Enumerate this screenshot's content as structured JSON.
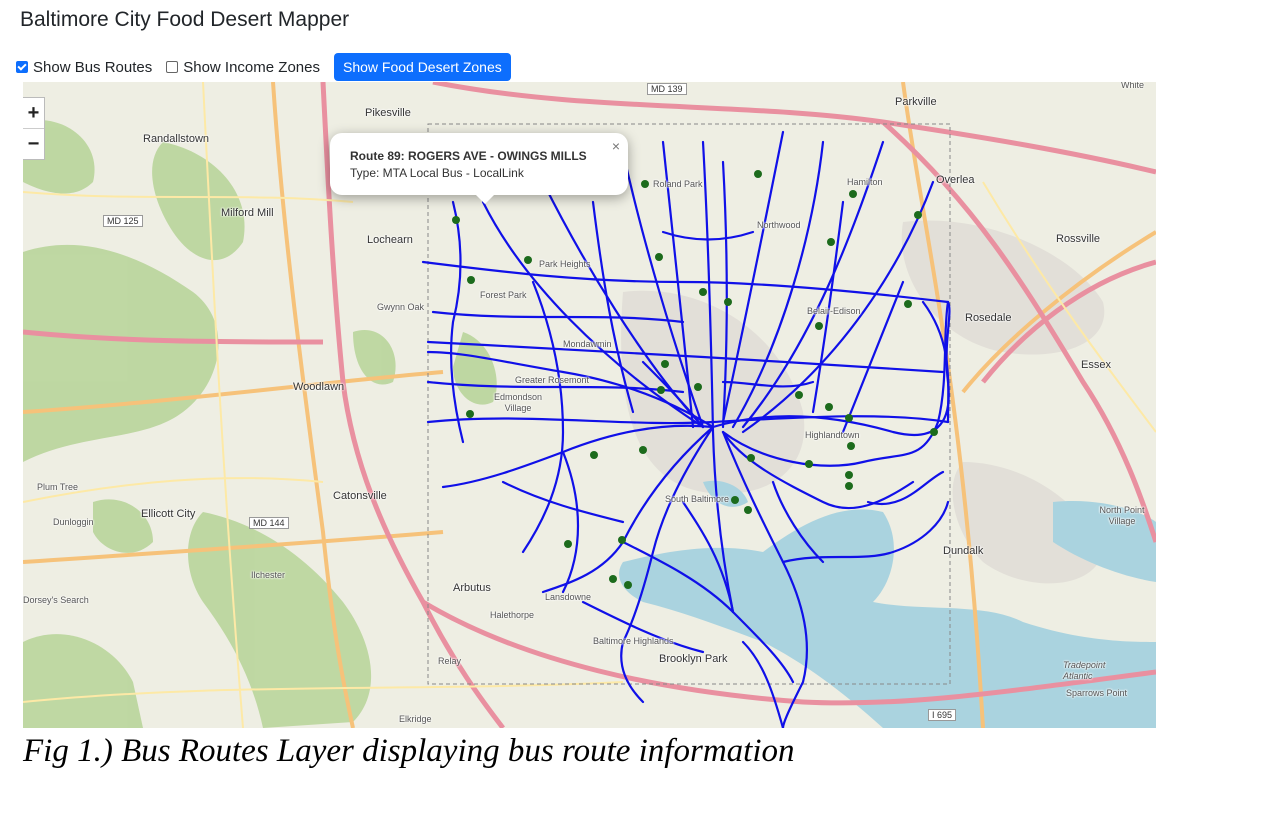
{
  "app": {
    "title": "Baltimore City Food Desert Mapper"
  },
  "controls": {
    "bus_routes_label": "Show Bus Routes",
    "bus_routes_checked": true,
    "income_zones_label": "Show Income Zones",
    "income_zones_checked": false,
    "food_desert_button": "Show Food Desert Zones"
  },
  "map": {
    "zoom_in": "+",
    "zoom_out": "−",
    "popup": {
      "title": "Route 89: ROGERS AVE - OWINGS MILLS",
      "type": "Type: MTA Local Bus - LocalLink",
      "close": "×"
    },
    "route_color": "#1010e8",
    "stop_color": "#1c6b1c",
    "places": [
      "Pikesville",
      "Randallstown",
      "Milford Mill",
      "Lochearn",
      "Gwynn Oak",
      "Woodlawn",
      "Catonsville",
      "Ellicott City",
      "Dunloggin",
      "Plum Tree",
      "Arbutus",
      "Halethorpe",
      "Lansdowne",
      "Baltimore Highlands",
      "Brooklyn Park",
      "Relay",
      "Elkridge",
      "Ilchester",
      "Parkville",
      "Hamilton",
      "Overlea",
      "Rossville",
      "Rosedale",
      "Essex",
      "Dundalk",
      "North Point Village",
      "Sparrows Point",
      "Tradepoint Atlantic",
      "Roland Park",
      "Park Heights",
      "Forest Park",
      "Mondawmin",
      "Greater Rosemont",
      "Edmondson Village",
      "Highlandtown",
      "South Baltimore",
      "Northwood",
      "Belair-Edison",
      "Dorsey's Search",
      "White"
    ],
    "shields": [
      "MD 139",
      "MD 125",
      "MD 144",
      "I 695"
    ]
  },
  "caption": "Fig 1.) Bus Routes Layer displaying bus route information"
}
